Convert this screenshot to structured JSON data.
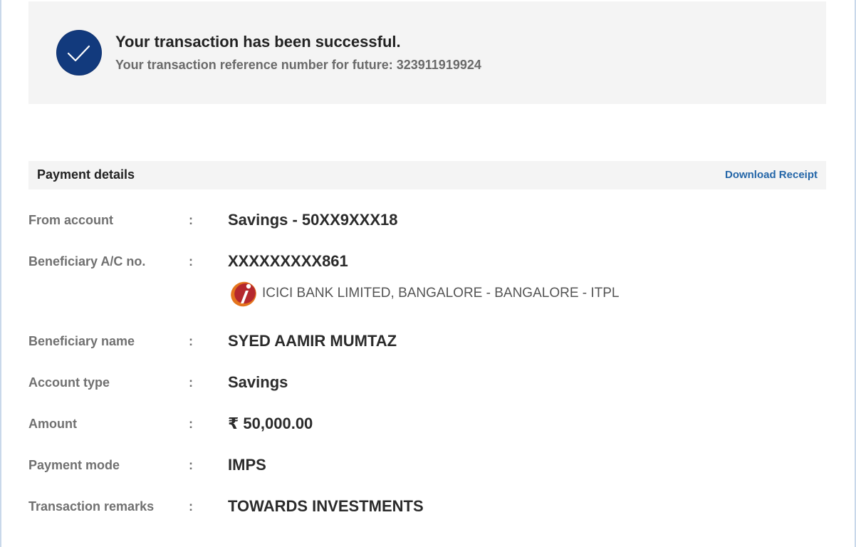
{
  "success": {
    "title": "Your transaction has been successful.",
    "reference": "Your transaction reference number for future: 323911919924",
    "icon": "checkmark-circle-icon",
    "icon_color": "#123a7d"
  },
  "payment_details": {
    "title": "Payment details",
    "download_label": "Download Receipt",
    "link_color": "#2466a8",
    "separator": ":",
    "rows": [
      {
        "label": "From account",
        "value": "Savings - 50XX9XXX18"
      },
      {
        "label": "Beneficiary A/C no.",
        "value": "XXXXXXXXX861"
      },
      {
        "label": "Beneficiary name",
        "value": "SYED AAMIR MUMTAZ"
      },
      {
        "label": "Account type",
        "value": "Savings"
      },
      {
        "label": "Amount",
        "value": "₹ 50,000.00"
      },
      {
        "label": "Payment mode",
        "value": "IMPS"
      },
      {
        "label": "Transaction remarks",
        "value": "TOWARDS INVESTMENTS"
      }
    ],
    "bank": {
      "name": "ICICI BANK LIMITED, BANGALORE - BANGALORE - ITPL",
      "logo": "icici-bank-logo"
    }
  }
}
